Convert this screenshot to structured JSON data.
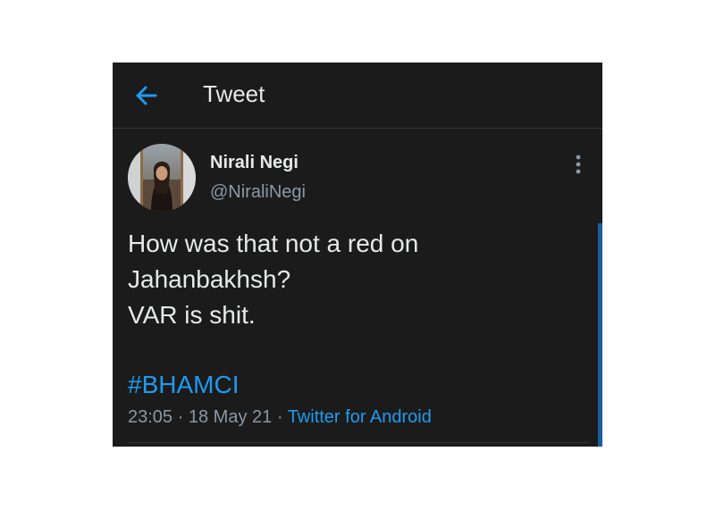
{
  "header": {
    "title": "Tweet",
    "back_icon": "arrow-left-icon"
  },
  "tweet": {
    "author_name": "Nirali Negi",
    "author_handle": "@NiraliNegi",
    "text_lines": [
      "How was that not a red on",
      "Jahanbakhsh?",
      "VAR is shit."
    ],
    "hashtag": "#BHAMCI",
    "time": "23:05",
    "separator": "·",
    "date": "18 May 21",
    "source": "Twitter for Android",
    "more_icon": "more-vertical-icon"
  },
  "colors": {
    "background": "#1b1b1b",
    "accent": "#1d9bf0",
    "text": "#e7e9ea",
    "muted": "#8b98a5"
  }
}
